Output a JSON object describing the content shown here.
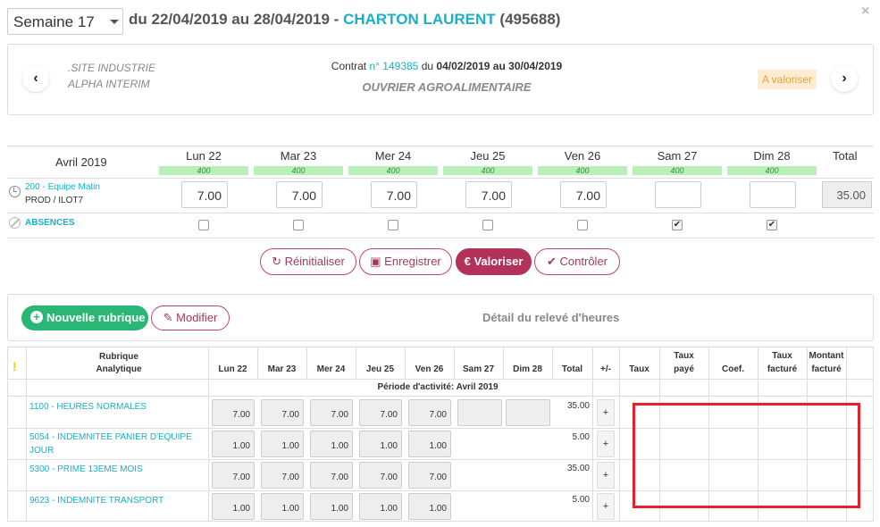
{
  "header": {
    "week": "Semaine 17",
    "range": "du 22/04/2019 au 28/04/2019 -",
    "employee": "CHARTON LAURENT",
    "employee_id": "(495688)",
    "close": "×"
  },
  "contract": {
    "site_line1": ".SITE INDUSTRIE",
    "site_line2": "ALPHA INTERIM",
    "prefix": "Contrat",
    "number": "n° 149385",
    "period_prefix": "du",
    "start": "04/02/2019",
    "period_mid": "au",
    "end": "30/04/2019",
    "job": "OUVRIER AGROALIMENTAIRE",
    "status": "A valoriser",
    "prev": "‹",
    "next": "›"
  },
  "week": {
    "month": "Avril 2019",
    "total_label": "Total",
    "days": [
      {
        "label": "Lun 22",
        "bar": "400",
        "hours": "7.00",
        "absence": false
      },
      {
        "label": "Mar 23",
        "bar": "400",
        "hours": "7.00",
        "absence": false
      },
      {
        "label": "Mer 24",
        "bar": "400",
        "hours": "7.00",
        "absence": false
      },
      {
        "label": "Jeu 25",
        "bar": "400",
        "hours": "7.00",
        "absence": false
      },
      {
        "label": "Ven 26",
        "bar": "400",
        "hours": "7.00",
        "absence": false
      },
      {
        "label": "Sam 27",
        "bar": "400",
        "hours": "",
        "absence": true
      },
      {
        "label": "Dim 28",
        "bar": "400",
        "hours": "",
        "absence": true
      }
    ],
    "team": "200 - Equipe Matin",
    "location": "PROD / ILOT7",
    "total": "35.00",
    "absences_label": "ABSENCES"
  },
  "actions": {
    "reset": "Réinitialiser",
    "save": "Enregistrer",
    "valorize": "€ Valoriser",
    "control": "Contrôler"
  },
  "detail": {
    "new_button": "Nouvelle rubrique",
    "edit_button": "Modifier",
    "title": "Détail du relevé d'heures",
    "headers": {
      "rubrique": "Rubrique",
      "analytique": "Analytique",
      "days": [
        "Lun 22",
        "Mar 23",
        "Mer 24",
        "Jeu 25",
        "Ven 26",
        "Sam 27",
        "Dim 28"
      ],
      "total": "Total",
      "plusminus": "+/-",
      "taux": "Taux",
      "taux_paye_1": "Taux",
      "taux_paye_2": "payé",
      "coef": "Coef.",
      "taux_facture_1": "Taux",
      "taux_facture_2": "facturé",
      "montant_1": "Montant",
      "montant_2": "facturé"
    },
    "warning": "!",
    "period": "Période d'activité: Avril 2019",
    "rows": [
      {
        "name": "1100 - HEURES NORMALES",
        "values": [
          "7.00",
          "7.00",
          "7.00",
          "7.00",
          "7.00"
        ],
        "total": "35.00",
        "plus": "+"
      },
      {
        "name": "5054 - INDEMNITEE PANIER D'EQUIPE JOUR",
        "values": [
          "1.00",
          "1.00",
          "1.00",
          "1.00",
          "1.00"
        ],
        "total": "5.00",
        "plus": "+"
      },
      {
        "name": "5300 - PRIME 13EME MOIS",
        "values": [
          "7.00",
          "7.00",
          "7.00",
          "7.00",
          "7.00"
        ],
        "total": "35.00",
        "plus": "+"
      },
      {
        "name": "9623 - INDEMNITE TRANSPORT",
        "values": [
          "1.00",
          "1.00",
          "1.00",
          "1.00",
          "1.00"
        ],
        "total": "5.00",
        "plus": "+"
      }
    ]
  },
  "colors": {
    "accent": "#1ab0c8",
    "brand": "#b3325a",
    "success": "#2ab674",
    "highlight": "#e8202a"
  }
}
